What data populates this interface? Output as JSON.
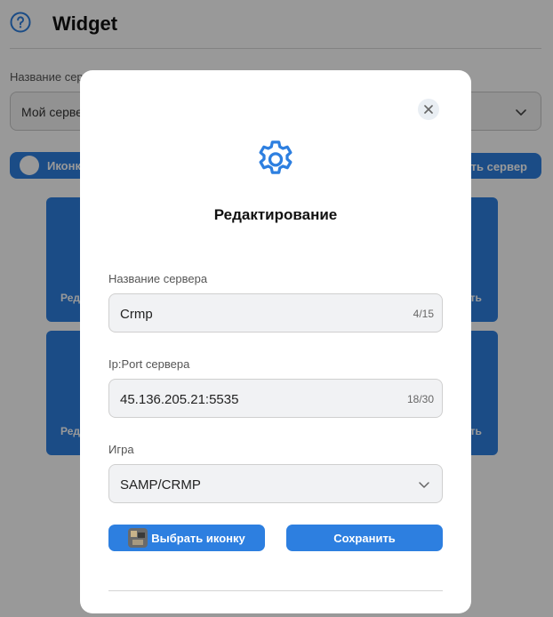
{
  "background": {
    "title": "Widget",
    "field_label": "Название сер",
    "server_input_value": "Мой сервер",
    "toggle_label": "Иконк",
    "add_button_label": "ть сервер",
    "cards": [
      {
        "label": "Реда"
      },
      {
        "label": "ать"
      },
      {
        "label": "Реда"
      },
      {
        "label": "ать"
      }
    ]
  },
  "modal": {
    "title": "Редактирование",
    "fields": {
      "server_name": {
        "label": "Название сервера",
        "value": "Crmp",
        "counter": "4/15"
      },
      "ip_port": {
        "label": "Ip:Port сервера",
        "value": "45.136.205.21:5535",
        "counter": "18/30"
      },
      "game": {
        "label": "Игра",
        "value": "SAMP/CRMP"
      }
    },
    "buttons": {
      "choose_icon": "Выбрать иконку",
      "save": "Сохранить"
    }
  },
  "colors": {
    "accent": "#2d7fe0",
    "overlay": "rgba(0,0,0,0.40)"
  },
  "icons": {
    "help": "question-circle-icon",
    "settings": "gear-icon",
    "close": "close-icon",
    "dropdown": "chevron-down-icon"
  }
}
